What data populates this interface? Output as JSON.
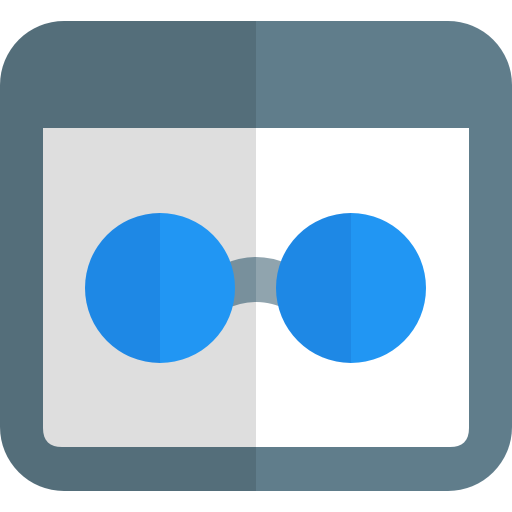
{
  "icon": {
    "name": "browser-window-with-glasses",
    "colors": {
      "frame_left": "#546E7A",
      "frame_right": "#607D8B",
      "panel_left": "#DEDEDE",
      "panel_right": "#FFFFFF",
      "lens_left_half": "#1E88E5",
      "lens_right_half": "#2196F3",
      "bridge_left": "#78909C",
      "bridge_right": "#90A4AE"
    }
  }
}
